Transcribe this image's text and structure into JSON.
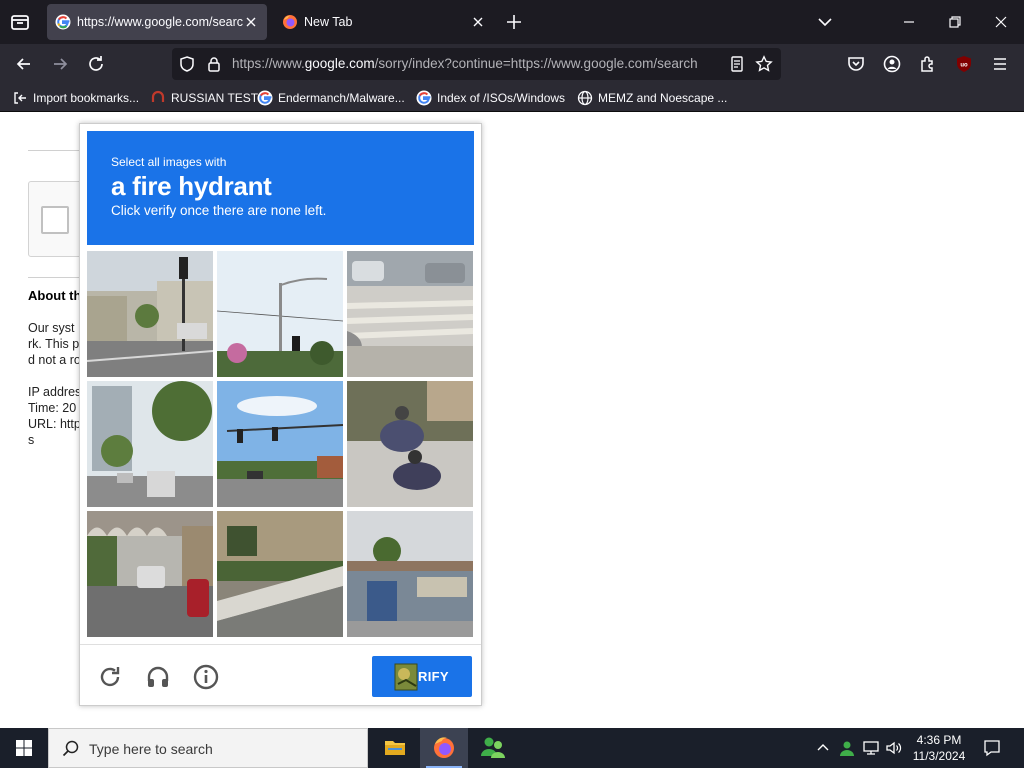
{
  "browser": {
    "tabs": [
      {
        "title": "https://www.google.com/search",
        "favicon": "google-icon",
        "active": true
      },
      {
        "title": "New Tab",
        "favicon": "firefox-icon",
        "active": false
      }
    ],
    "url": {
      "prefix": "https://www.",
      "domain": "google.com",
      "rest": "/sorry/index?continue=https://www.google.com/search"
    },
    "bookmarks": [
      {
        "label": "Import bookmarks...",
        "icon": "import-icon"
      },
      {
        "label": "RUSSIAN TEST",
        "icon": "bookmark-icon"
      },
      {
        "label": "Endermanch/Malware...",
        "icon": "google-icon"
      },
      {
        "label": "Index of /ISOs/Windows",
        "icon": "google-icon"
      },
      {
        "label": "MEMZ and Noescape ...",
        "icon": "globe-icon"
      }
    ],
    "accent": "#1a73e8"
  },
  "page": {
    "about_heading": "About th",
    "lines": [
      "Our syst",
      "rk. This p",
      "d not a ro",
      "IP addres",
      "Time: 20",
      "URL: http",
      "s"
    ]
  },
  "captcha": {
    "instruction_small": "Select all images with",
    "target": "a fire hydrant",
    "instruction_sub": "Click verify once there are none left.",
    "verify_label": "RIFY",
    "tiles": [
      "street-with-traffic-light",
      "pole-and-traffic-light",
      "crosswalk-curb",
      "city-street-buildings",
      "intersection-traffic-lights",
      "motorcycle-riders",
      "highway-under-bridge",
      "street-curb-with-grass",
      "storefront-shops"
    ]
  },
  "taskbar": {
    "search_placeholder": "Type here to search",
    "time": "4:36 PM",
    "date": "11/3/2024"
  }
}
